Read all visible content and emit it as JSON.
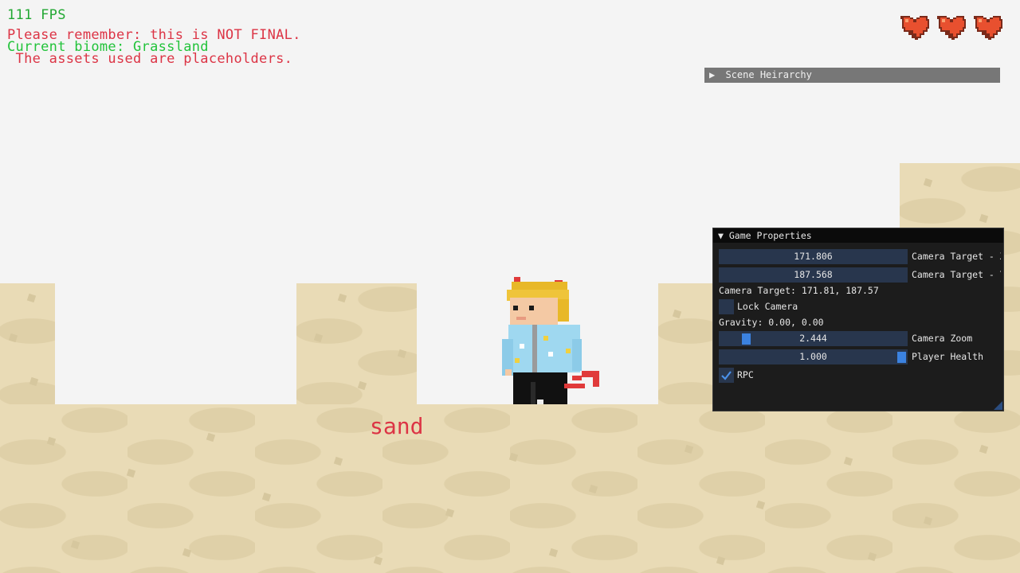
{
  "hud": {
    "fps": "111 FPS",
    "notice_line1": "Please remember: this is NOT FINAL.",
    "biome": "Current biome: Grassland",
    "notice_line2": " The assets used are placeholders.",
    "fps_color": "#22a833",
    "notice_color": "#dc3445",
    "biome_color": "#22c33a"
  },
  "health": {
    "hearts": 3,
    "filled": 3,
    "heart_color": "#e8502f"
  },
  "world": {
    "block_label": "sand"
  },
  "scene_hierarchy": {
    "title": "Scene Heirarchy",
    "collapsed": true
  },
  "game_properties": {
    "title": "Game Properties",
    "camera_target_x": {
      "value": "171.806",
      "label": "Camera Target - X"
    },
    "camera_target_y": {
      "value": "187.568",
      "label": "Camera Target - Y"
    },
    "camera_target_text": "Camera Target: 171.81, 187.57",
    "lock_camera": {
      "label": "Lock Camera",
      "checked": false
    },
    "gravity_text": "Gravity: 0.00, 0.00",
    "camera_zoom": {
      "value": "2.444",
      "label": "Camera Zoom"
    },
    "player_health": {
      "value": "1.000",
      "label": "Player Health"
    },
    "rpc": {
      "label": "RPC",
      "checked": true
    }
  }
}
